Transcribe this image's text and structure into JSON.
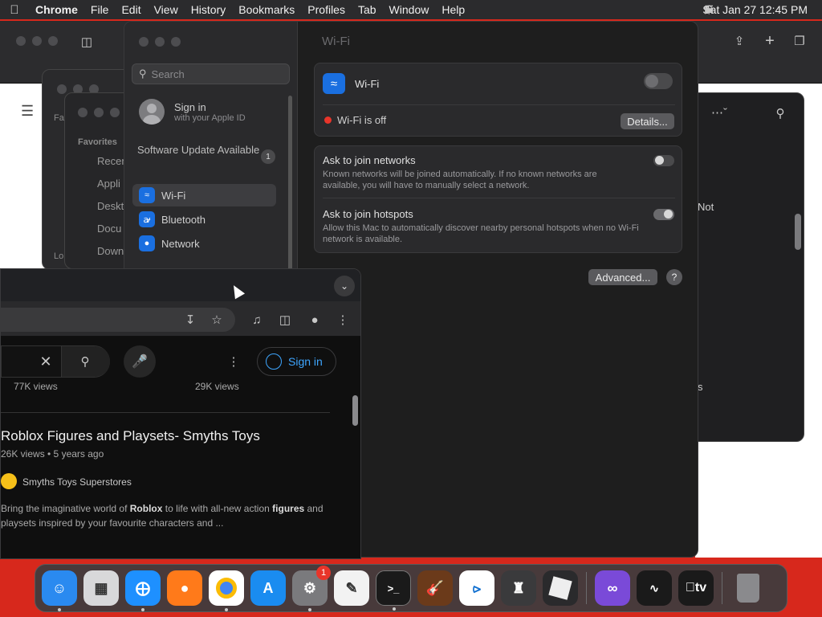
{
  "menubar": {
    "app_name": "Chrome",
    "menus": [
      "File",
      "Edit",
      "View",
      "History",
      "Bookmarks",
      "Profiles",
      "Tab",
      "Window",
      "Help"
    ],
    "clock": "Sat Jan 27  12:45 PM"
  },
  "finder": {
    "favorites_label": "Favorites",
    "items": [
      "Recen",
      "Appli",
      "Deskt",
      "Docu",
      "Down"
    ],
    "fa_label": "Fa",
    "lo_label": "Lo"
  },
  "right_window": {
    "text_not": "Not",
    "text_s": "s"
  },
  "settings": {
    "search_placeholder": "Search",
    "signin_title": "Sign in",
    "signin_subtitle": "with your Apple ID",
    "software_update": "Software Update Available",
    "software_update_count": "1",
    "nav": [
      {
        "label": "Wi-Fi",
        "selected": true
      },
      {
        "label": "Bluetooth",
        "selected": false
      },
      {
        "label": "Network",
        "selected": false
      }
    ],
    "pane_title": "Wi-Fi",
    "wifi_label": "Wi-Fi",
    "wifi_status": "Wi-Fi is off",
    "details_button": "Details...",
    "ask_networks_title": "Ask to join networks",
    "ask_networks_desc": "Known networks will be joined automatically. If no known networks are available, you will have to manually select a network.",
    "ask_hotspots_title": "Ask to join hotspots",
    "ask_hotspots_desc": "Allow this Mac to automatically discover nearby personal hotspots when no Wi-Fi network is available.",
    "advanced_button": "Advanced...",
    "help_button": "?",
    "colors": {
      "accent": "#1a6fe0",
      "status_off": "#e8352a"
    }
  },
  "youtube": {
    "sign_in": "Sign in",
    "views_left": "77K views",
    "views_right": "29K views",
    "video_title": "Roblox Figures and Playsets- Smyths Toys",
    "video_meta": "26K views • 5 years ago",
    "channel": "Smyths Toys Superstores",
    "desc_1": "Bring the imaginative world of ",
    "desc_b1": "Roblox",
    "desc_2": " to life with all-new action ",
    "desc_b2": "figures",
    "desc_3": " and playsets inspired by your favourite characters and ..."
  },
  "dock": {
    "apps": [
      {
        "name": "Finder",
        "color": "#2a8af0",
        "running": true
      },
      {
        "name": "Launchpad",
        "color": "#d8d8da",
        "running": false
      },
      {
        "name": "Safari",
        "color": "#1e90ff",
        "running": true
      },
      {
        "name": "Firefox",
        "color": "#ff7a1a",
        "running": false
      },
      {
        "name": "Chrome",
        "color": "#ffffff",
        "running": true
      },
      {
        "name": "App Store",
        "color": "#1a8cf0",
        "running": false
      },
      {
        "name": "System Settings",
        "color": "#7a7a7d",
        "running": true,
        "badge": "1"
      },
      {
        "name": "TextEdit",
        "color": "#f2f2f2",
        "running": false
      },
      {
        "name": "Terminal",
        "color": "#1a1a1a",
        "running": true
      },
      {
        "name": "GarageBand",
        "color": "#6b3a1a",
        "running": false
      },
      {
        "name": "VS Code",
        "color": "#0f6fd0",
        "running": false
      },
      {
        "name": "Bartender",
        "color": "#3a3a3c",
        "running": false
      },
      {
        "name": "Roblox",
        "color": "#2a2a2c",
        "running": false
      }
    ],
    "apps_right": [
      {
        "name": "Visual Studio",
        "color": "#7a4ad8",
        "running": false
      },
      {
        "name": "Activity Monitor",
        "color": "#1a1a1a",
        "running": false
      },
      {
        "name": "TV",
        "color": "#1a1a1a",
        "running": false,
        "label": "tv"
      },
      {
        "name": "Trash",
        "color": "#6a6a6d",
        "running": false
      }
    ]
  }
}
